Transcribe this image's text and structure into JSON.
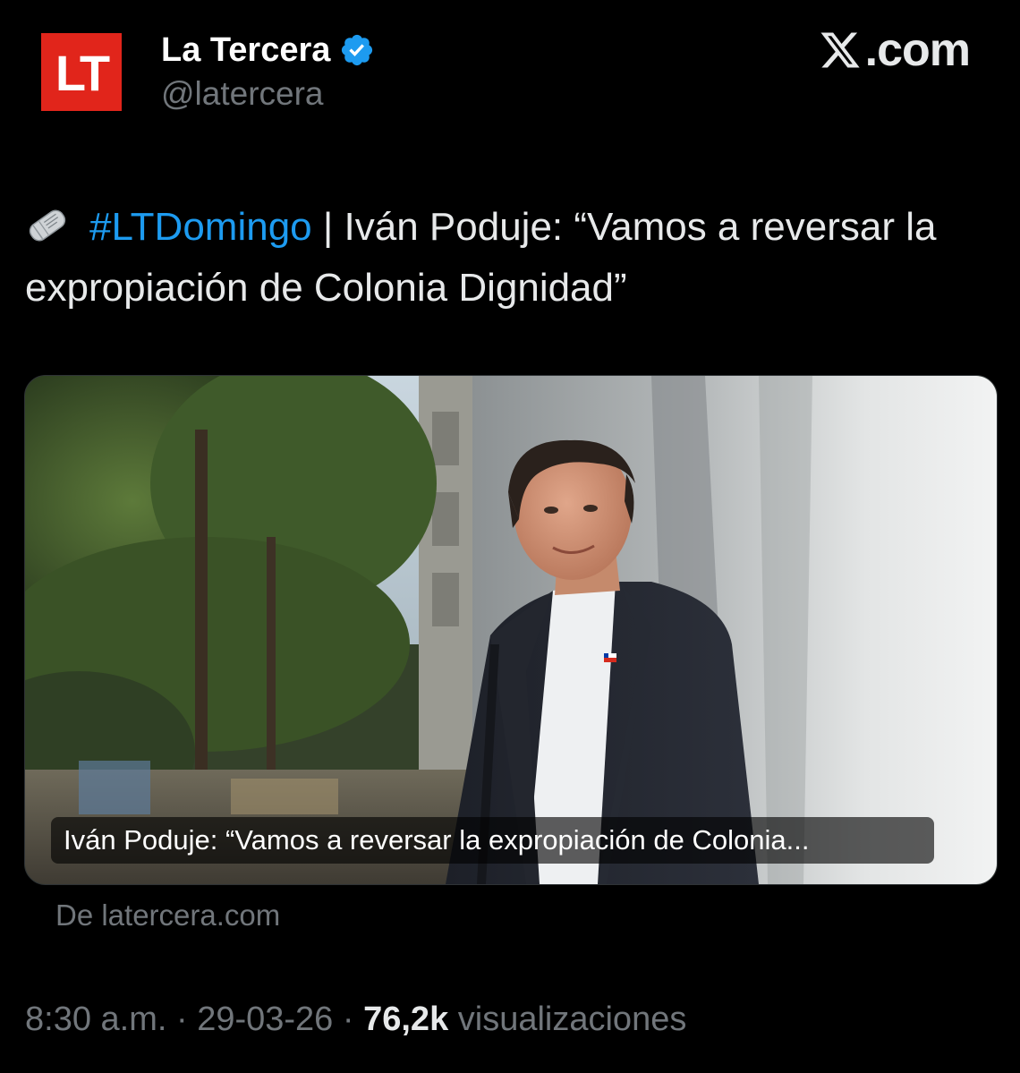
{
  "account": {
    "avatar_text": "LT",
    "name": "La Tercera",
    "handle": "@latercera",
    "verified_icon": "verified-badge-icon",
    "brand_color": "#e1251b"
  },
  "brand": {
    "icon": "x-logo-icon",
    "domain": ".com"
  },
  "tweet": {
    "emoji_icon": "rolled-newspaper-icon",
    "hashtag": "#LTDomingo",
    "separator": " | ",
    "body": "Iván Poduje: “Vamos a reversar la expropiación de Colonia Dignidad”"
  },
  "card": {
    "title": "Iván Poduje: “Vamos a reversar la expropiación de Colonia...",
    "source": "De latercera.com"
  },
  "meta": {
    "time": "8:30 a.m.",
    "dot1": " · ",
    "date": "29-03-26",
    "dot2": " · ",
    "views": "76,2k",
    "views_label": " visualizaciones"
  },
  "colors": {
    "background": "#000000",
    "text": "#e7e9ea",
    "secondary": "#71767b",
    "link": "#1d9bf0"
  }
}
